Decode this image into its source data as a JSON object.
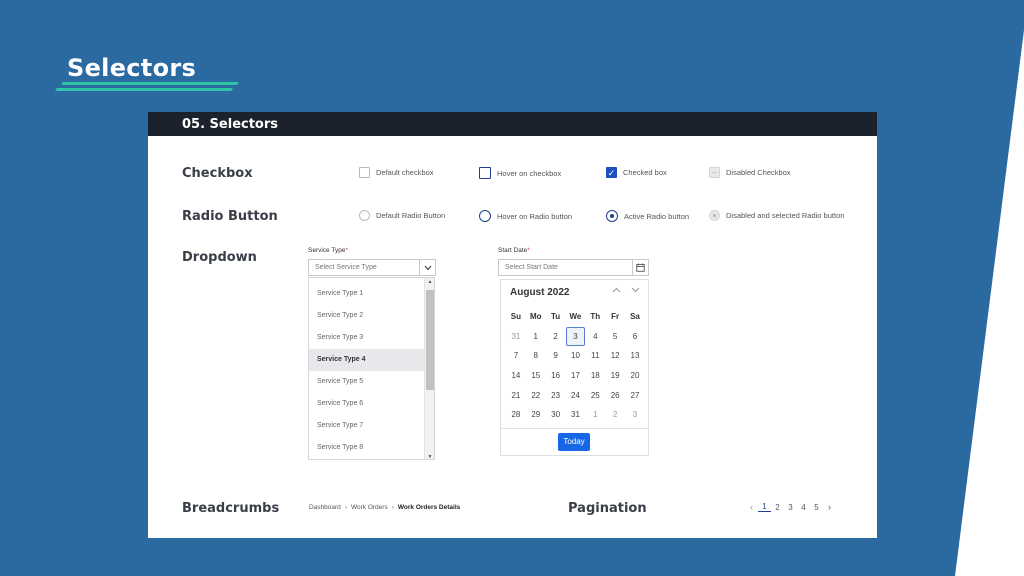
{
  "slide": {
    "title": "Selectors"
  },
  "panel": {
    "header": "05. Selectors"
  },
  "colors": {
    "background": "#2a6aa0",
    "accent_line": "#2ec4a6",
    "primary": "#1f4fbf",
    "header_bg": "#1b222b",
    "today_button": "#1766e6"
  },
  "checkbox": {
    "label": "Checkbox",
    "options": [
      {
        "label": "Default checkbox",
        "state": "default"
      },
      {
        "label": "Hover on checkbox",
        "state": "hover"
      },
      {
        "label": "Checked box",
        "state": "checked"
      },
      {
        "label": "Disabled Checkbox",
        "state": "disabled"
      }
    ]
  },
  "radio": {
    "label": "Radio Button",
    "options": [
      {
        "label": "Default Radio Button",
        "state": "default"
      },
      {
        "label": "Hover on Radio button",
        "state": "hover"
      },
      {
        "label": "Active Radio button",
        "state": "active"
      },
      {
        "label": "Disabled and selected Radio button",
        "state": "disabled"
      }
    ]
  },
  "dropdown": {
    "label": "Dropdown",
    "service": {
      "field_label": "Service Type",
      "required_mark": "*",
      "placeholder": "Select Service Type",
      "caret_icon": "chevron-down-icon",
      "items": [
        "Service Type 1",
        "Service Type 2",
        "Service Type 3",
        "Service Type 4",
        "Service Type 5",
        "Service Type 6",
        "Service Type 7",
        "Service Type 8"
      ],
      "highlighted": "Service Type 4"
    },
    "date": {
      "field_label": "Start Date",
      "required_mark": "*",
      "placeholder": "Select Start Date",
      "calendar_icon": "calendar-icon",
      "calendar": {
        "month_label": "August 2022",
        "weekdays": [
          "Su",
          "Mo",
          "Tu",
          "We",
          "Th",
          "Fr",
          "Sa"
        ],
        "weeks": [
          [
            "31",
            "1",
            "2",
            "3",
            "4",
            "5",
            "6"
          ],
          [
            "7",
            "8",
            "9",
            "10",
            "11",
            "12",
            "13"
          ],
          [
            "14",
            "15",
            "16",
            "17",
            "18",
            "19",
            "20"
          ],
          [
            "21",
            "22",
            "23",
            "24",
            "25",
            "26",
            "27"
          ],
          [
            "28",
            "29",
            "30",
            "31",
            "1",
            "2",
            "3"
          ]
        ],
        "selected": "3",
        "today_label": "Today"
      }
    }
  },
  "breadcrumbs": {
    "label": "Breadcrumbs",
    "items": [
      "Dashboard",
      "Work Orders",
      "Work Orders Details"
    ]
  },
  "pagination": {
    "label": "Pagination",
    "pages": [
      "1",
      "2",
      "3",
      "4",
      "5"
    ],
    "active": "1",
    "prev_icon": "chevron-left-icon",
    "next_icon": "chevron-right-icon"
  }
}
